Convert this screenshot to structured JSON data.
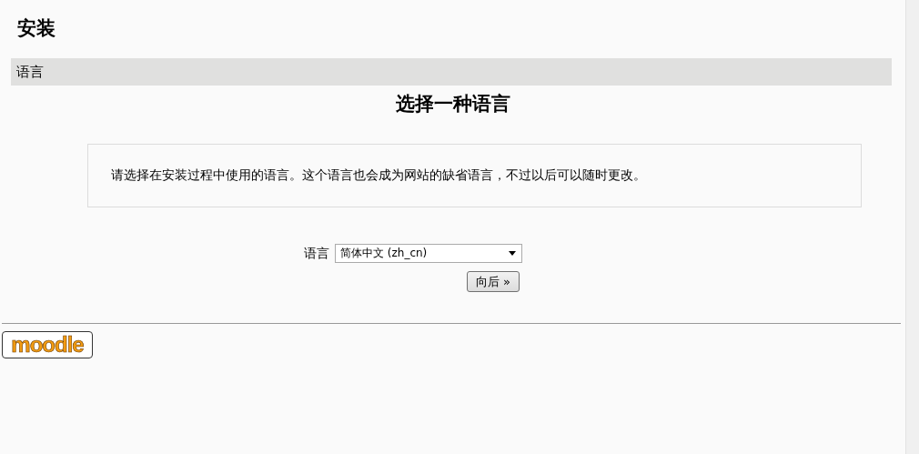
{
  "page_title": "安装",
  "section_bar": {
    "label": "语言"
  },
  "heading": "选择一种语言",
  "notice": "请选择在安装过程中使用的语言。这个语言也会成为网站的缺省语言，不过以后可以随时更改。",
  "form": {
    "label": "语言",
    "select_value": "简体中文  (zh_cn)",
    "button": "向后 »"
  },
  "footer_logo": {
    "text": "moodle"
  }
}
